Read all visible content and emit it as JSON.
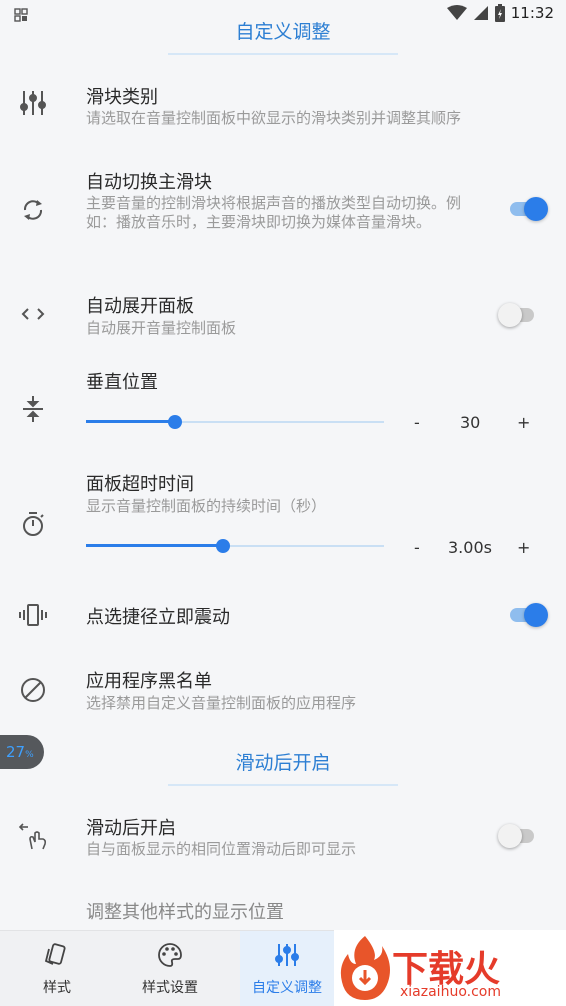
{
  "status_bar": {
    "time": "11:32"
  },
  "sections": {
    "custom_title": "自定义调整",
    "swipe_title": "滑动后开启"
  },
  "items": {
    "slider_category": {
      "title": "滑块类别",
      "desc": "请选取在音量控制面板中欲显示的滑块类别并调整其顺序"
    },
    "auto_switch": {
      "title": "自动切换主滑块",
      "desc": "主要音量的控制滑块将根据声音的播放类型自动切换。例如：播放音乐时，主要滑块即切换为媒体音量滑块。",
      "enabled": true
    },
    "auto_expand": {
      "title": "自动展开面板",
      "desc": "自动展开音量控制面板",
      "enabled": false
    },
    "vertical_pos": {
      "title": "垂直位置",
      "value": "30",
      "minus": "-",
      "plus": "+",
      "fraction": 0.3
    },
    "panel_timeout": {
      "title": "面板超时时间",
      "desc": "显示音量控制面板的持续时间（秒）",
      "value": "3.00s",
      "minus": "-",
      "plus": "+",
      "fraction": 0.46
    },
    "vibrate": {
      "title": "点选捷径立即震动",
      "enabled": true
    },
    "blacklist": {
      "title": "应用程序黑名单",
      "desc": "选择禁用自定义音量控制面板的应用程序"
    },
    "swipe_open": {
      "title": "滑动后开启",
      "desc": "自与面板显示的相同位置滑动后即可显示",
      "enabled": false
    },
    "other_position": {
      "title": "调整其他样式的显示位置"
    }
  },
  "badge": {
    "text": "27",
    "unit": "%"
  },
  "nav": {
    "tabs": [
      {
        "label": "样式",
        "icon": "style-icon"
      },
      {
        "label": "样式设置",
        "icon": "palette-icon"
      },
      {
        "label": "自定义调整",
        "icon": "sliders-icon",
        "active": true
      }
    ]
  },
  "watermark": {
    "brand": "下载火",
    "url": "xiazaihuo.com"
  },
  "colors": {
    "accent": "#2b7de9",
    "section": "#2d7fd3",
    "desc": "#9a9a9a"
  }
}
